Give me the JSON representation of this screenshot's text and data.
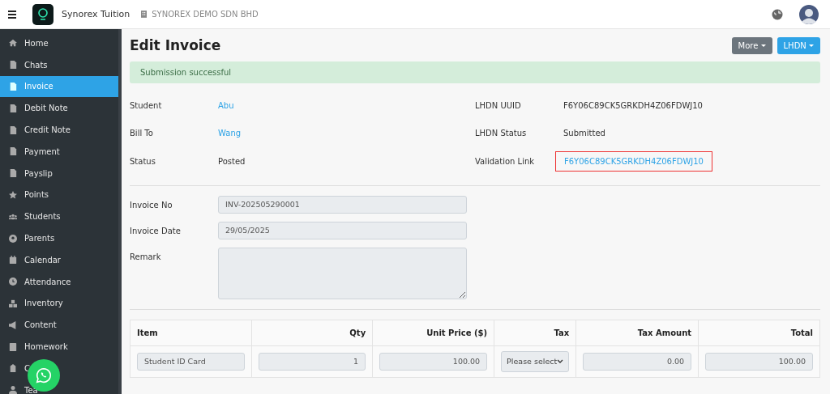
{
  "header": {
    "app_name": "Synorex Tuition",
    "company": "SYNOREX DEMO SDN BHD"
  },
  "sidebar": {
    "items": [
      {
        "label": "Home",
        "kind": "home",
        "selected": false
      },
      {
        "label": "Chats",
        "kind": "doc",
        "selected": false
      },
      {
        "label": "Invoice",
        "kind": "doc",
        "selected": true
      },
      {
        "label": "Debit Note",
        "kind": "doc",
        "selected": false
      },
      {
        "label": "Credit Note",
        "kind": "doc",
        "selected": false
      },
      {
        "label": "Payment",
        "kind": "doc",
        "selected": false
      },
      {
        "label": "Payslip",
        "kind": "doc",
        "selected": false
      },
      {
        "label": "Points",
        "kind": "star",
        "selected": false
      },
      {
        "label": "Students",
        "kind": "users",
        "selected": false
      },
      {
        "label": "Parents",
        "kind": "user",
        "selected": false
      },
      {
        "label": "Calendar",
        "kind": "calendar",
        "selected": false
      },
      {
        "label": "Attendance",
        "kind": "clock",
        "selected": false
      },
      {
        "label": "Inventory",
        "kind": "boxes",
        "selected": false
      },
      {
        "label": "Content",
        "kind": "megaphone",
        "selected": false
      },
      {
        "label": "Homework",
        "kind": "book",
        "selected": false
      },
      {
        "label": "C",
        "kind": "school",
        "selected": false
      },
      {
        "label": "Tea",
        "kind": "person",
        "selected": false
      }
    ]
  },
  "page": {
    "title": "Edit Invoice",
    "buttons": [
      {
        "label": "More",
        "kind": "secondary"
      },
      {
        "label": "LHDN",
        "kind": "primary"
      }
    ]
  },
  "alert": "Submission successful",
  "info_left": [
    {
      "label": "Student",
      "value": "Abu",
      "kind": "link"
    },
    {
      "label": "Bill To",
      "value": "Wang",
      "kind": "link"
    },
    {
      "label": "Status",
      "value": "Posted",
      "kind": "text"
    }
  ],
  "info_right": [
    {
      "label": "LHDN UUID",
      "value": "F6Y06C89CK5GRKDH4Z06FDWJ10",
      "kind": "text",
      "highlighted": false
    },
    {
      "label": "LHDN Status",
      "value": "Submitted",
      "kind": "text",
      "highlighted": false
    },
    {
      "label": "Validation Link",
      "value": "F6Y06C89CK5GRKDH4Z06FDWJ10",
      "kind": "link",
      "highlighted": true
    }
  ],
  "form": [
    {
      "label": "Invoice No",
      "value": "INV-202505290001",
      "kind": "input"
    },
    {
      "label": "Invoice Date",
      "value": "29/05/2025",
      "kind": "input"
    },
    {
      "label": "Remark",
      "kind": "textarea"
    }
  ],
  "table": {
    "columns": [
      "Item",
      "Qty",
      "Unit Price ($)",
      "Tax",
      "Tax Amount",
      "Total"
    ],
    "rows": [
      {
        "item": "Student ID Card",
        "qty": "1",
        "unit_price": "100.00",
        "tax": {
          "placeholder": "Please select"
        },
        "tax_amount": "0.00",
        "total": "100.00"
      }
    ]
  }
}
